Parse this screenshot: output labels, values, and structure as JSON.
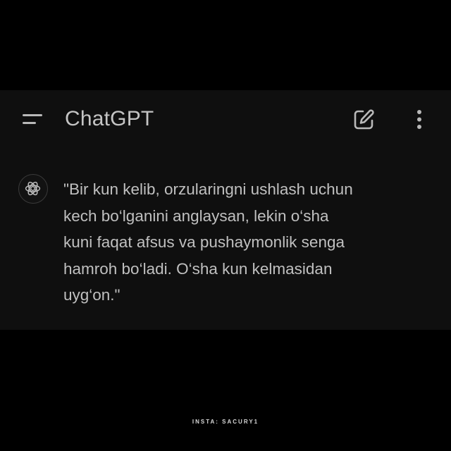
{
  "header": {
    "title": "ChatGPT",
    "menu_icon": "hamburger-menu-icon",
    "new_chat_icon": "edit-icon",
    "more_icon": "more-vertical-icon"
  },
  "message": {
    "avatar_icon": "openai-logo-icon",
    "text": "\"Bir kun kelib, orzularingni ushlash uchun\nkech bo‘lganini anglaysan, lekin o‘sha\nkuni faqat afsus va pushaymonlik senga\nhamroh bo‘ladi. O‘sha kun kelmasidan\nuyg‘on.\""
  },
  "watermark": "INSTA: SACURY1",
  "colors": {
    "background": "#000000",
    "panel": "#0f0f0f",
    "text": "#c0c0c0",
    "icon": "#b9b9b9"
  }
}
